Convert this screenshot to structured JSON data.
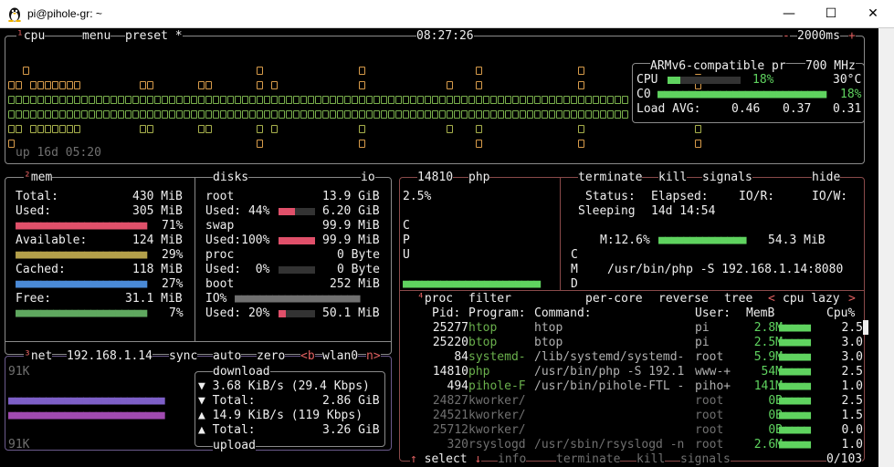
{
  "window": {
    "title": "pi@pihole-gr: ~",
    "minimize": "—",
    "maximize": "☐",
    "close": "✕"
  },
  "cpu": {
    "tab_num": "¹",
    "tab_label": "cpu",
    "menu_label": "menu",
    "preset_label": "preset *",
    "clock": "08:27:26",
    "minus": "-",
    "interval": "2000ms",
    "plus": "+",
    "model": "ARMv6-compatible pr",
    "freq": "700 MHz",
    "cpu_label": "CPU",
    "cpu_pct": "18%",
    "temp": "30°C",
    "cpu_fraction": 0.18,
    "core_label": "C0",
    "core_pct": "18%",
    "load_label": "Load AVG:",
    "load1": "0.46",
    "load5": "0.37",
    "load15": "0.31",
    "uptime": "up 16d 05:20"
  },
  "mem": {
    "tab_num": "²",
    "label": "mem",
    "total_label": "Total:",
    "total": "430 MiB",
    "used_label": "Used:",
    "used": "305 MiB",
    "used_pct": "71%",
    "avail_label": "Available:",
    "avail": "124 MiB",
    "avail_pct": "29%",
    "cached_label": "Cached:",
    "cached": "118 MiB",
    "cached_pct": "27%",
    "free_label": "Free:",
    "free": "31.1 MiB",
    "free_pct": "7%"
  },
  "disks": {
    "label": "disks",
    "io_label": "io",
    "root": "root",
    "root_size": "13.9 GiB",
    "root_used_label": "Used: 44%",
    "root_used": "6.20 GiB",
    "root_frac": 0.44,
    "swap": "swap",
    "swap_size": "99.9 MiB",
    "swap_used_label": "Used:100%",
    "swap_used": "99.9 MiB",
    "swap_frac": 1.0,
    "proc": "proc",
    "proc_size": "0 Byte",
    "proc_used_label": "Used:  0%",
    "proc_used": "0 Byte",
    "proc_frac": 0.0,
    "boot": "boot",
    "boot_size": "252 MiB",
    "io_pct": "IO%",
    "boot_used_label": "Used: 20%",
    "boot_used": "50.1 MiB",
    "boot_frac": 0.2
  },
  "net": {
    "tab_num": "³",
    "label": "net",
    "ip": "192.168.1.14",
    "sync": "sync",
    "auto": "auto",
    "zero": "zero",
    "prev": "<b",
    "iface": "wlan0",
    "next": "n>",
    "scale_top": "91K",
    "scale_bottom": "91K",
    "download": "download",
    "dl_rate": "3.68 KiB/s (29.4 Kbps)",
    "dl_total_label": "Total:",
    "dl_total": "2.86 GiB",
    "ul_rate": "14.9 KiB/s (119 Kbps)",
    "ul_total_label": "Total:",
    "ul_total": "3.26 GiB",
    "upload": "upload"
  },
  "detail": {
    "pid": "14810",
    "name": "php",
    "cpu_pct": "2.5%",
    "terminate": "terminate",
    "kill": "kill",
    "signals": "signals",
    "hide": "hide",
    "status_label": "Status:",
    "elapsed_label": "Elapsed:",
    "ior_label": "IO/R:",
    "iow_label": "IO/W:",
    "status": "Sleeping",
    "elapsed": "14d 14:54",
    "mem_label": "M:12.6%",
    "mem_value": "54.3 MiB",
    "cmd_label_c": "C",
    "cmd_label_m": "M",
    "cmd_label_d": "D",
    "vert_c": "C",
    "vert_p": "P",
    "vert_u": "U",
    "cmd": "/usr/bin/php -S 192.168.1.14:8080"
  },
  "proc": {
    "tab_num": "⁴",
    "label": "proc",
    "filter": "filter",
    "per_core": "per-core",
    "reverse": "reverse",
    "tree": "tree",
    "sort_prev": "<",
    "sort": "cpu lazy",
    "sort_next": ">",
    "headers": {
      "pid": "Pid:",
      "program": "Program:",
      "command": "Command:",
      "user": "User:",
      "mem": "MemB",
      "cpu": "Cpu%"
    },
    "rows": [
      {
        "pid": "25277",
        "program": "htop",
        "command": "htop",
        "user": "pi",
        "mem": "2.8M",
        "cpu": "2.5"
      },
      {
        "pid": "25220",
        "program": "btop",
        "command": "btop",
        "user": "pi",
        "mem": "2.5M",
        "cpu": "3.0"
      },
      {
        "pid": "84",
        "program": "systemd-",
        "command": "/lib/systemd/systemd-",
        "user": "root",
        "mem": "5.9M",
        "cpu": "3.0"
      },
      {
        "pid": "14810",
        "program": "php",
        "command": "/usr/bin/php -S 192.1",
        "user": "www-+",
        "mem": "54M",
        "cpu": "2.5"
      },
      {
        "pid": "494",
        "program": "pihole-F",
        "command": "/usr/bin/pihole-FTL -",
        "user": "piho+",
        "mem": "141M",
        "cpu": "1.0"
      },
      {
        "pid": "24827",
        "program": "kworker/",
        "command": "",
        "user": "root",
        "mem": "0B",
        "cpu": "2.5"
      },
      {
        "pid": "24521",
        "program": "kworker/",
        "command": "",
        "user": "root",
        "mem": "0B",
        "cpu": "1.5"
      },
      {
        "pid": "25712",
        "program": "kworker/",
        "command": "",
        "user": "root",
        "mem": "0B",
        "cpu": "0.0"
      },
      {
        "pid": "320",
        "program": "rsyslogd",
        "command": "/usr/sbin/rsyslogd -n",
        "user": "root",
        "mem": "2.6M",
        "cpu": "1.0"
      }
    ],
    "footer_select": "↑ select ↓",
    "footer_info": "info",
    "footer_terminate": "terminate",
    "footer_kill": "kill",
    "footer_signals": "signals",
    "count": "0/103"
  },
  "colors": {
    "accent_red": "#e06060",
    "green": "#5fd35f",
    "orange": "#d79b4a",
    "purple": "#7d5fc7",
    "blue": "#4a8ad7",
    "red_bar": "#e0506a"
  }
}
